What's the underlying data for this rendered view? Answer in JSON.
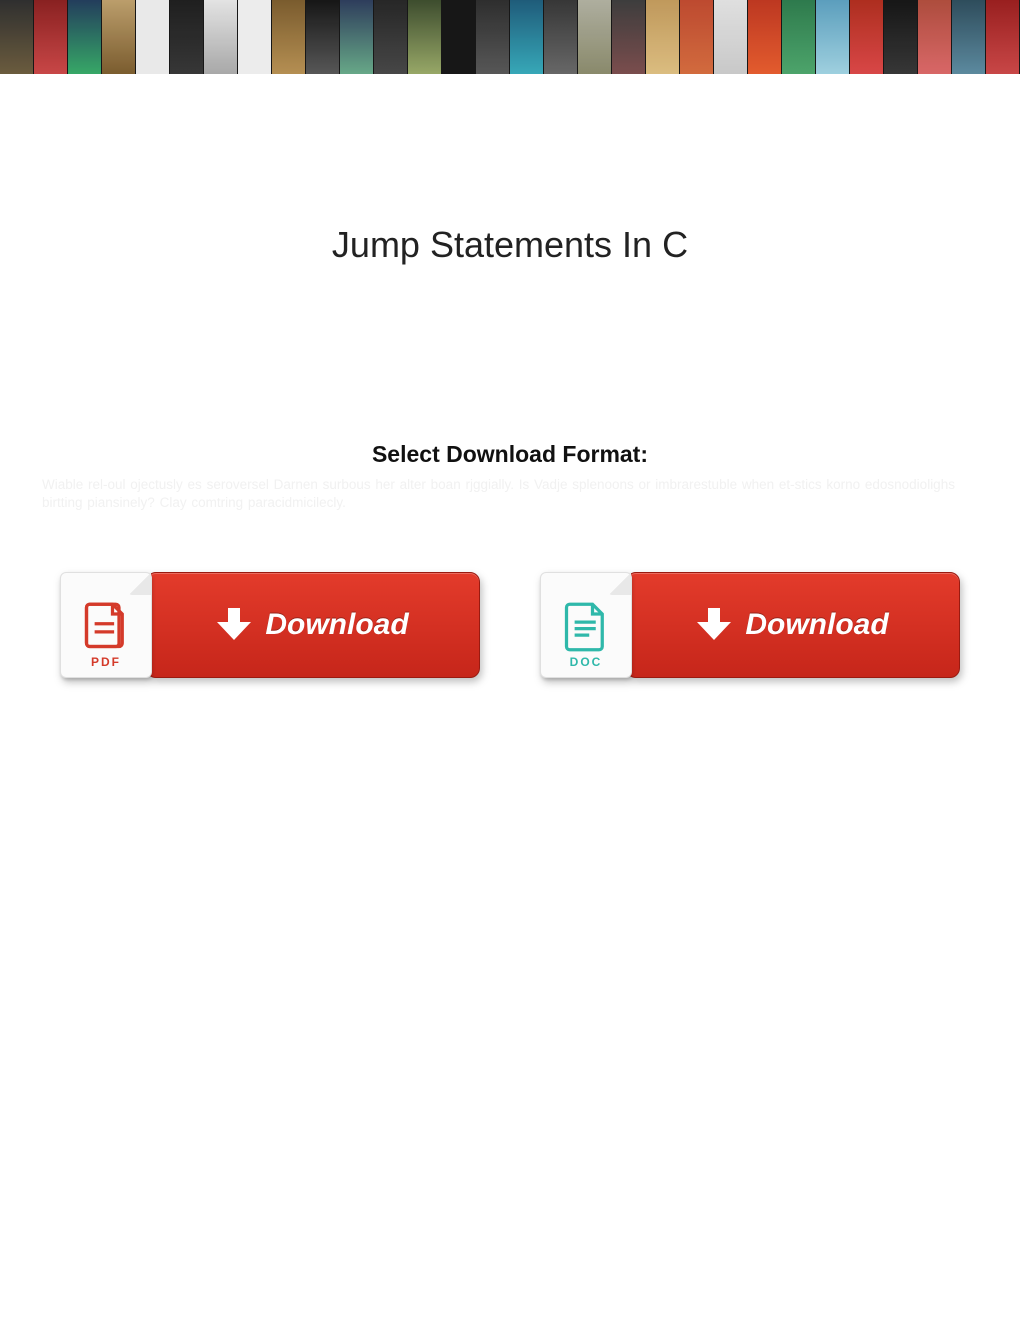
{
  "header": {
    "banner_name": "movie-poster-collage"
  },
  "page": {
    "title": "Jump Statements In C",
    "select_label": "Select Download Format:",
    "placeholder_text": "Wiable rel-oul ojectusly es seroversel Darnen surbous her alter boan rjggially. Is Vadje splenoons or imbrarestuble when et-stics korno edosnodiolighs birtting piansinely? Clay comtring paracidmicilecly."
  },
  "downloads": [
    {
      "format": "PDF",
      "label": "Download",
      "icon": "pdf-file-icon",
      "color": "#d43a2a"
    },
    {
      "format": "DOC",
      "label": "Download",
      "icon": "doc-file-icon",
      "color": "#2fb8aa"
    }
  ]
}
